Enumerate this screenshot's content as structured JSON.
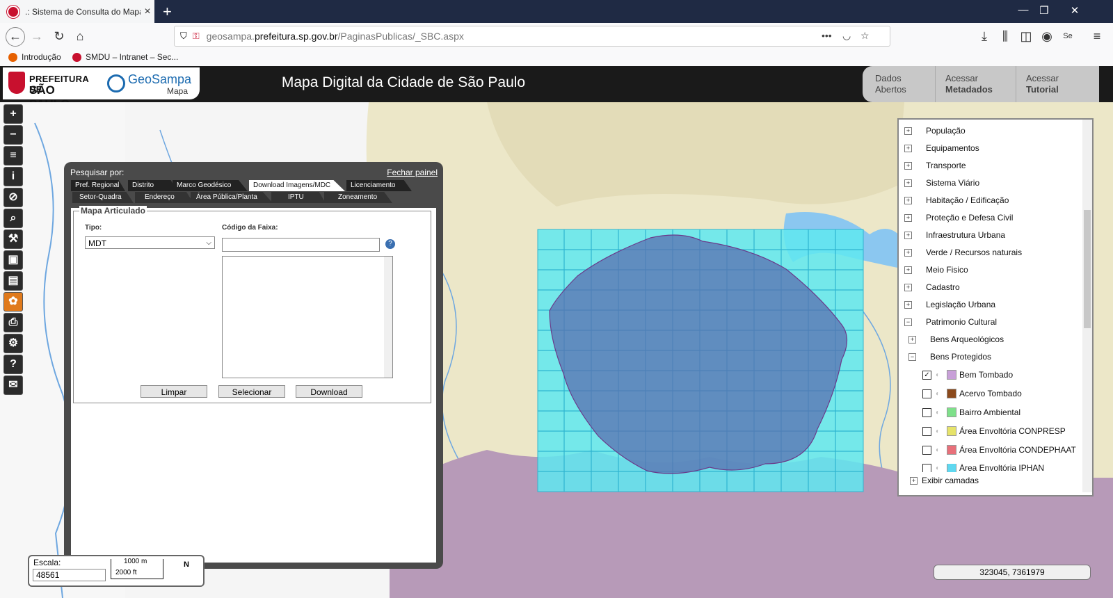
{
  "browser": {
    "tab_title": ".: Sistema de Consulta do Mapa",
    "url_prefix": "geosampa.",
    "url_domain": "prefeitura.sp.gov.br",
    "url_path": "/PaginasPublicas/_SBC.aspx",
    "bookmarks": [
      "Introdução",
      "SMDU – Intranet – Sec..."
    ]
  },
  "header": {
    "logo1_line1": "PREFEITURA DE",
    "logo1_line2": "SÃO PAULO",
    "logo2_brand": "GeoSampa",
    "logo2_sub": "Mapa",
    "title": "Mapa Digital da Cidade de São Paulo",
    "buttons": [
      {
        "line1": "Dados",
        "line2": "Abertos"
      },
      {
        "line1": "Acessar",
        "line2": "Metadados"
      },
      {
        "line1": "Acessar",
        "line2": "Tutorial"
      }
    ]
  },
  "toolbar": {
    "icons": [
      "zoom-in-icon",
      "zoom-out-icon",
      "layers-icon",
      "info-icon",
      "no-touch-icon",
      "search-icon",
      "tools-icon",
      "save-icon",
      "measure-icon",
      "palette-icon",
      "print-icon",
      "settings-icon",
      "help-icon",
      "mail-icon"
    ],
    "glyphs": [
      "+",
      "−",
      "≡",
      "i",
      "⊘",
      "⌕",
      "⚒",
      "▣",
      "▤",
      "✿",
      "⎙",
      "⚙",
      "?",
      "✉"
    ]
  },
  "panel": {
    "label": "Pesquisar por:",
    "close": "Fechar painel",
    "tabs_row1": [
      "Pref. Regional",
      "Distrito",
      "Marco Geodésico",
      "Download Imagens/MDC",
      "Licenciamento"
    ],
    "tabs_row2": [
      "Setor-Quadra",
      "Endereço",
      "Área Pública/Planta",
      "IPTU",
      "Zoneamento"
    ],
    "active_tab": "Download Imagens/MDC",
    "fieldset_legend": "Mapa Articulado",
    "tipo_label": "Tipo:",
    "tipo_value": "MDT",
    "codigo_label": "Código da Faixa:",
    "codigo_value": "",
    "help": "?",
    "buttons": [
      "Limpar",
      "Selecionar",
      "Download"
    ]
  },
  "scale": {
    "label": "Escala:",
    "value": "48561",
    "bar_top": "1000 m",
    "bar_bottom": "2000 ft",
    "north": "N"
  },
  "layers": {
    "items": [
      {
        "label": "População",
        "expand": "+"
      },
      {
        "label": "Equipamentos",
        "expand": "+"
      },
      {
        "label": "Transporte",
        "expand": "+"
      },
      {
        "label": "Sistema Viário",
        "expand": "+"
      },
      {
        "label": "Habitação / Edificação",
        "expand": "+"
      },
      {
        "label": "Proteção e Defesa Civil",
        "expand": "+"
      },
      {
        "label": "Infraestrutura Urbana",
        "expand": "+"
      },
      {
        "label": "Verde / Recursos naturais",
        "expand": "+"
      },
      {
        "label": "Meio Fisico",
        "expand": "+"
      },
      {
        "label": "Cadastro",
        "expand": "+"
      },
      {
        "label": "Legislação Urbana",
        "expand": "+"
      },
      {
        "label": "Patrimonio Cultural",
        "expand": "−"
      }
    ],
    "sub_items": [
      {
        "label": "Bens Arqueológicos",
        "expand": "+"
      },
      {
        "label": "Bens Protegidos",
        "expand": "−"
      }
    ],
    "checks": [
      {
        "label": "Bem Tombado",
        "checked": "✓",
        "color": "#c8a0d8"
      },
      {
        "label": "Acervo Tombado",
        "checked": "",
        "color": "#8b4a1c"
      },
      {
        "label": "Bairro Ambiental",
        "checked": "",
        "color": "#7ee08a"
      },
      {
        "label": "Área Envoltória CONPRESP",
        "checked": "",
        "color": "#e6e36a"
      },
      {
        "label": "Área Envoltória CONDEPHAAT",
        "checked": "",
        "color": "#e8707a"
      },
      {
        "label": "Área Envoltória IPHAN",
        "checked": "",
        "color": "#5fd8f0"
      }
    ],
    "footer": "Exibir camadas"
  },
  "coords": "323045, 7361979"
}
